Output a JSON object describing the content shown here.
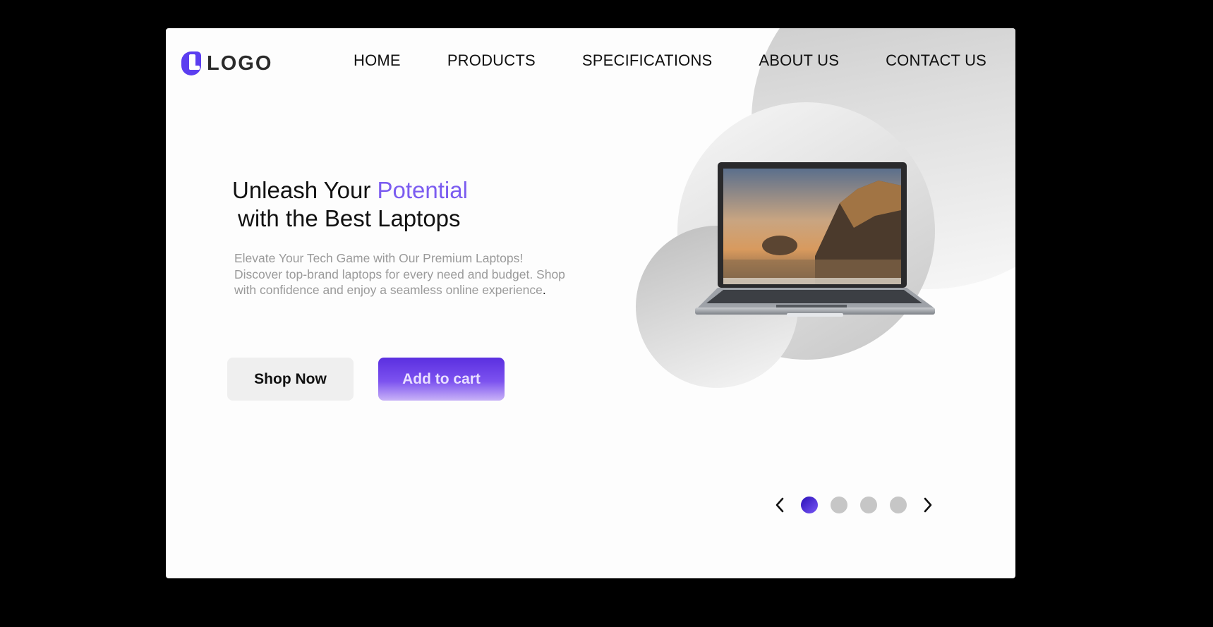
{
  "header": {
    "logo_text": "LOGO",
    "nav": [
      "HOME",
      "PRODUCTS",
      "SPECIFICATIONS",
      "ABOUT US",
      "CONTACT US"
    ]
  },
  "hero": {
    "title_part1": "Unleash Your ",
    "title_accent": "Potential",
    "title_line2": "with the Best Laptops",
    "description": "Elevate Your Tech Game with Our Premium Laptops! Discover top-brand laptops for every need and budget. Shop with confidence and enjoy a seamless online experience",
    "description_end": "."
  },
  "buttons": {
    "shop_now": "Shop Now",
    "add_to_cart": "Add to cart"
  },
  "carousel": {
    "slide_count": 4,
    "active_index": 0
  },
  "icons": {
    "prev": "chevron-left-icon",
    "next": "chevron-right-icon",
    "product": "laptop-image"
  },
  "colors": {
    "accent": "#7b5cf0",
    "cart_button": "#5a2fe0",
    "active_dot": "#2a10b8",
    "inactive_dot": "#c6c6c6"
  }
}
